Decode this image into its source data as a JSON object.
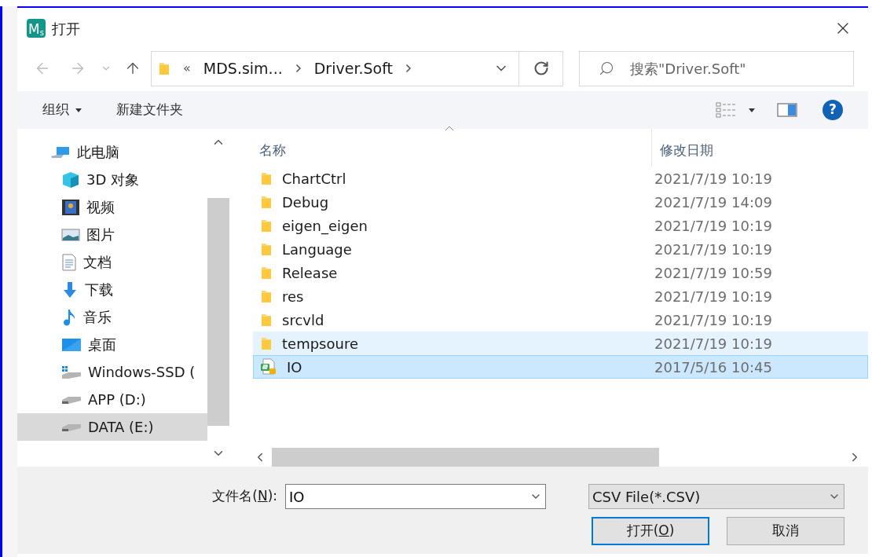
{
  "window": {
    "title": "打开",
    "app_icon": {
      "letter": "M",
      "sub": "s"
    }
  },
  "nav": {
    "path_prefix": "«",
    "breadcrumbs": [
      "MDS.sim...",
      "Driver.Soft"
    ],
    "search": {
      "placeholder": "搜索\"Driver.Soft\""
    }
  },
  "toolbar": {
    "items": [
      "组织",
      "新建文件夹"
    ],
    "help": "?"
  },
  "sidebar": {
    "items": [
      {
        "label": "此电脑",
        "kind": "computer",
        "selected": false,
        "children": [
          {
            "label": "3D 对象",
            "kind": "cube",
            "selected": false
          },
          {
            "label": "视频",
            "kind": "film",
            "selected": false
          },
          {
            "label": "图片",
            "kind": "image",
            "selected": false
          },
          {
            "label": "文档",
            "kind": "document",
            "selected": false
          },
          {
            "label": "下载",
            "kind": "download",
            "selected": false
          },
          {
            "label": "音乐",
            "kind": "music",
            "selected": false
          },
          {
            "label": "桌面",
            "kind": "desktop",
            "selected": false
          },
          {
            "label": "Windows-SSD (",
            "kind": "windrive",
            "selected": false
          },
          {
            "label": "APP (D:)",
            "kind": "drive",
            "selected": false
          },
          {
            "label": "DATA (E:)",
            "kind": "drive",
            "selected": true
          }
        ]
      }
    ]
  },
  "table": {
    "columns": [
      "名称",
      "修改日期"
    ],
    "rows": [
      {
        "name": "ChartCtrl",
        "date": "2021/7/19 10:19",
        "kind": "folder",
        "selected": false,
        "hovered": false
      },
      {
        "name": "Debug",
        "date": "2021/7/19 14:09",
        "kind": "folder",
        "selected": false,
        "hovered": false
      },
      {
        "name": "eigen_eigen",
        "date": "2021/7/19 10:19",
        "kind": "folder",
        "selected": false,
        "hovered": false
      },
      {
        "name": "Language",
        "date": "2021/7/19 10:19",
        "kind": "folder",
        "selected": false,
        "hovered": false
      },
      {
        "name": "Release",
        "date": "2021/7/19 10:59",
        "kind": "folder",
        "selected": false,
        "hovered": false
      },
      {
        "name": "res",
        "date": "2021/7/19 10:19",
        "kind": "folder",
        "selected": false,
        "hovered": false
      },
      {
        "name": "srcvld",
        "date": "2021/7/19 10:19",
        "kind": "folder",
        "selected": false,
        "hovered": false
      },
      {
        "name": "tempsoure",
        "date": "2021/7/19 10:19",
        "kind": "folder",
        "selected": false,
        "hovered": true
      },
      {
        "name": "IO",
        "date": "2017/5/16 10:45",
        "kind": "csv",
        "selected": true,
        "hovered": false
      }
    ]
  },
  "footer": {
    "filename_label": {
      "before": "文件名(",
      "key": "N",
      "after": "):"
    },
    "filename": "IO",
    "filetype": "CSV File(*.CSV)",
    "buttons": [
      {
        "before": "打开(",
        "key": "O",
        "after": ")",
        "default": true
      },
      {
        "before": "取消",
        "default": false
      }
    ]
  }
}
